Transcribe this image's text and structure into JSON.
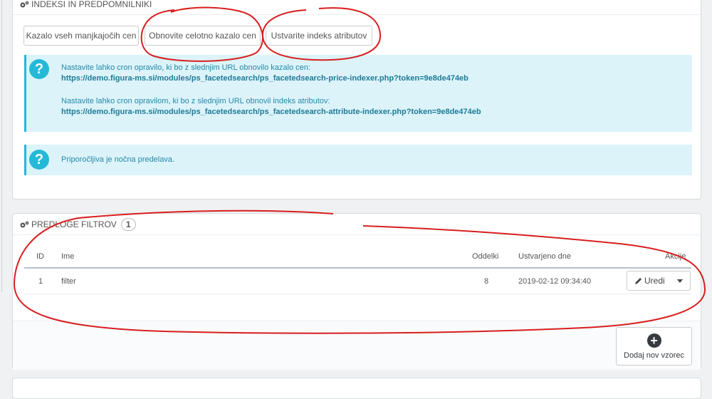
{
  "indexes_panel": {
    "title": "INDEKSI IN PREDPOMNILNIKI",
    "buttons": [
      "Kazalo vseh manjkajočih cen",
      "Obnovite celotno kazalo cen",
      "Ustvarite indeks atributov"
    ],
    "info": {
      "price_text": "Nastavite lahko cron opravilo, ki bo z slednjim URL obnovilo kazalo cen:",
      "price_url": "https://demo.figura-ms.si/modules/ps_facetedsearch/ps_facetedsearch-price-indexer.php?token=9e8de474eb",
      "attr_text": "Nastavite lahko cron opravilom, ki bo z slednjim URL obnovil indeks atributov:",
      "attr_url": "https://demo.figura-ms.si/modules/ps_facetedsearch/ps_facetedsearch-attribute-indexer.php?token=9e8de474eb"
    },
    "recommendation": "Priporočljiva je nočna predelava."
  },
  "templates_panel": {
    "title": "PREDLOGE FILTROV",
    "count": "1",
    "columns": {
      "id": "ID",
      "name": "Ime",
      "sections": "Oddelki",
      "created": "Ustvarjeno dne",
      "actions": "Akcije"
    },
    "rows": [
      {
        "id": "1",
        "name": "filter",
        "sections": "8",
        "created": "2019-02-12 09:34:40"
      }
    ],
    "edit_label": "Uredi",
    "add_label": "Dodaj nov vzorec"
  },
  "colors": {
    "info_bg": "#dcf3fa",
    "info_border": "#25b9d7",
    "annotation": "#d81e1e"
  }
}
